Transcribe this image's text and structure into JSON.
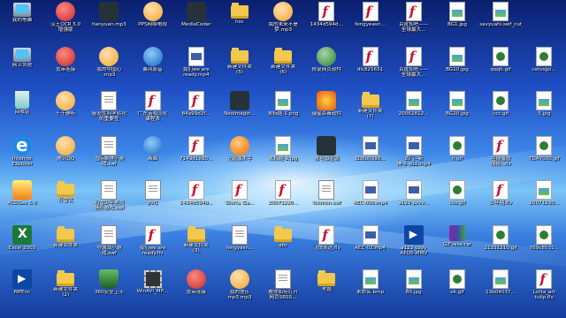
{
  "desktop": {
    "icons": [
      {
        "label": "我的电脑",
        "icon": "computer-icon",
        "kind": "computer",
        "col": 0,
        "row": 0
      },
      {
        "label": "汉王OCR 5.0\n增强版",
        "icon": "hanwang-ocr-icon",
        "kind": "round-red",
        "col": 1,
        "row": 0
      },
      {
        "label": "tianyuan.mp3",
        "icon": "mp3-file-icon",
        "kind": "dark",
        "col": 2,
        "row": 0
      },
      {
        "label": "PPS网络电视",
        "icon": "pps-tv-icon",
        "kind": "face",
        "col": 3,
        "row": 0
      },
      {
        "label": "MediaCoder",
        "icon": "mediacoder-icon",
        "kind": "dark",
        "col": 4,
        "row": 0
      },
      {
        "label": "hoc",
        "icon": "folder-icon",
        "kind": "folder",
        "col": 5,
        "row": 0
      },
      {
        "label": "我的未来不是\n梦.mp3",
        "icon": "mp3-file-icon",
        "kind": "face",
        "col": 6,
        "row": 0
      },
      {
        "label": "1434d594d…",
        "icon": "flash-file-icon",
        "kind": "flash",
        "col": 7,
        "row": 0
      },
      {
        "label": "fengyeasn…",
        "icon": "flash-file-icon",
        "kind": "flash",
        "col": 8,
        "row": 0
      },
      {
        "label": "百度知吧——\n全球最大…",
        "icon": "flash-file-icon",
        "kind": "flash",
        "col": 9,
        "row": 0
      },
      {
        "label": "BG1.jpg",
        "icon": "image-file-icon",
        "kind": "pic",
        "col": 10,
        "row": 0
      },
      {
        "label": "savyuahi.swf_cut_with…",
        "icon": "image-file-icon",
        "kind": "pic",
        "col": 11,
        "row": 0
      },
      {
        "label": "网上邻居",
        "icon": "network-icon",
        "kind": "computer",
        "col": 0,
        "row": 1
      },
      {
        "label": "宽带连接",
        "icon": "broadband-icon",
        "kind": "round-red",
        "col": 1,
        "row": 1
      },
      {
        "label": "我的中国心\n.mp3",
        "icon": "mp3-file-icon",
        "kind": "face",
        "col": 2,
        "row": 1
      },
      {
        "label": "暴风影音",
        "icon": "baofeng-icon",
        "kind": "round-blue",
        "col": 3,
        "row": 1
      },
      {
        "label": "我们we are\nready.mp4",
        "icon": "mp4-file-icon",
        "kind": "mp4",
        "col": 4,
        "row": 1
      },
      {
        "label": "新建文件夹\n(5)",
        "icon": "folder-icon",
        "kind": "folder",
        "col": 5,
        "row": 1
      },
      {
        "label": "新建文件夹\n(6)",
        "icon": "folder-icon",
        "kind": "folder",
        "col": 6,
        "row": 1
      },
      {
        "label": "修复网页软件",
        "icon": "repair-icon",
        "kind": "round-green",
        "col": 7,
        "row": 1
      },
      {
        "label": "dlc825651",
        "icon": "flash-file-icon",
        "kind": "flash",
        "col": 8,
        "row": 1
      },
      {
        "label": "百度知吧——\n全球最大…",
        "icon": "flash-file-icon",
        "kind": "flash",
        "col": 9,
        "row": 1
      },
      {
        "label": "BG10.jpg",
        "icon": "image-file-icon",
        "kind": "pic",
        "col": 10,
        "row": 1
      },
      {
        "label": "qqqh.gif",
        "icon": "gif-file-icon",
        "kind": "gif",
        "col": 11,
        "row": 1
      },
      {
        "label": "cetvsjpi…",
        "icon": "gif-file-icon",
        "kind": "gif",
        "col": 12,
        "row": 1
      },
      {
        "label": "回收站",
        "icon": "recycle-bin-icon",
        "kind": "recycle",
        "col": 0,
        "row": 2
      },
      {
        "label": "千千静听",
        "icon": "ttplayer-icon",
        "kind": "face",
        "col": 1,
        "row": 2
      },
      {
        "label": "秘密性科学转化\n的重要性",
        "icon": "document-icon",
        "kind": "doc",
        "col": 2,
        "row": 2
      },
      {
        "label": "广东话粤同化\n课程表",
        "icon": "flash-file-icon",
        "kind": "flash",
        "col": 3,
        "row": 2
      },
      {
        "label": "84a99d2f…",
        "icon": "flash-file-icon",
        "kind": "flash",
        "col": 4,
        "row": 2
      },
      {
        "label": "NeoImagin…",
        "icon": "neoimaging-icon",
        "kind": "dark",
        "col": 5,
        "row": 2
      },
      {
        "label": "未标题-1.png",
        "icon": "image-file-icon",
        "kind": "pic",
        "col": 6,
        "row": 2
      },
      {
        "label": "瑞星杀毒软件",
        "icon": "rising-antivirus-icon",
        "kind": "lion",
        "col": 7,
        "row": 2
      },
      {
        "label": "新建文件夹\n(7)",
        "icon": "folder-icon",
        "kind": "folder",
        "col": 8,
        "row": 2
      },
      {
        "label": "20062812…",
        "icon": "image-file-icon",
        "kind": "pic",
        "col": 9,
        "row": 2
      },
      {
        "label": "BG20.jpg",
        "icon": "image-file-icon",
        "kind": "pic",
        "col": 10,
        "row": 2
      },
      {
        "label": "ccc.gif",
        "icon": "gif-file-icon",
        "kind": "gif",
        "col": 11,
        "row": 2
      },
      {
        "label": "5.jpg",
        "icon": "image-file-icon",
        "kind": "pic",
        "col": 12,
        "row": 2
      },
      {
        "label": "Internet\nExplorer",
        "icon": "internet-explorer-icon",
        "kind": "ie",
        "col": 0,
        "row": 3
      },
      {
        "label": "腾讯QQ",
        "icon": "qq-icon",
        "kind": "face",
        "col": 1,
        "row": 3
      },
      {
        "label": "国际象棋小游\n戏.swf",
        "icon": "document-icon",
        "kind": "doc",
        "col": 2,
        "row": 3
      },
      {
        "label": "画面",
        "icon": "screen-icon",
        "kind": "round-blue",
        "col": 3,
        "row": 3
      },
      {
        "label": "7149d1e20…",
        "icon": "flash-file-icon",
        "kind": "flash",
        "col": 4,
        "row": 3
      },
      {
        "label": "光影魔术手",
        "icon": "nEO-iMAGING-icon",
        "kind": "round-orange",
        "col": 5,
        "row": 3
      },
      {
        "label": "未标题-2.jpg",
        "icon": "image-file-icon",
        "kind": "pic",
        "col": 6,
        "row": 3
      },
      {
        "label": "账号加密锁",
        "icon": "lock-icon",
        "kind": "dark",
        "col": 7,
        "row": 3
      },
      {
        "label": "SD8b0936…",
        "icon": "mp4-file-icon",
        "kind": "mp4",
        "col": 8,
        "row": 3
      },
      {
        "label": "西门--新\n神-6_ALL.mp4",
        "icon": "mp4-file-icon",
        "kind": "mp4",
        "col": 9,
        "row": 3
      },
      {
        "label": "h.gif",
        "icon": "gif-file-icon",
        "kind": "gif",
        "col": 10,
        "row": 3
      },
      {
        "label": "在线播放\n视频...flv",
        "icon": "flash-file-icon",
        "kind": "flash",
        "col": 11,
        "row": 3
      },
      {
        "label": "TDA7000.gif",
        "icon": "gif-file-icon",
        "kind": "gif",
        "col": 12,
        "row": 3
      },
      {
        "label": "ACDSee 5.0",
        "icon": "acdsee-icon",
        "kind": "acd",
        "col": 0,
        "row": 4
      },
      {
        "label": "打雪仗",
        "icon": "folder-icon",
        "kind": "folder",
        "col": 1,
        "row": 4
      },
      {
        "label": "初雪少年男同\n情小游戏.swf",
        "icon": "document-icon",
        "kind": "doc",
        "col": 2,
        "row": 4
      },
      {
        "label": "pvl1",
        "icon": "document-icon",
        "kind": "doc",
        "col": 3,
        "row": 4
      },
      {
        "label": "1434d594d…",
        "icon": "flash-file-icon",
        "kind": "flash",
        "col": 4,
        "row": 4
      },
      {
        "label": "Gloria_Ga…",
        "icon": "flash-file-icon",
        "kind": "flash",
        "col": 5,
        "row": 4
      },
      {
        "label": "20071220…",
        "icon": "flash-file-icon",
        "kind": "flash",
        "col": 6,
        "row": 4
      },
      {
        "label": "fokmon.swf",
        "icon": "document-icon",
        "kind": "doc",
        "col": 7,
        "row": 4
      },
      {
        "label": "AEC-005.mp4",
        "icon": "mp4-file-icon",
        "kind": "mp4",
        "col": 8,
        "row": 4
      },
      {
        "label": "a123-pzvv…",
        "icon": "mp4-file-icon",
        "kind": "mp4",
        "col": 9,
        "row": 4
      },
      {
        "label": "kku.gif",
        "icon": "gif-file-icon",
        "kind": "gif",
        "col": 10,
        "row": 4
      },
      {
        "label": "少年期.flv",
        "icon": "flash-file-icon",
        "kind": "flash",
        "col": 11,
        "row": 4
      },
      {
        "label": "20071230…",
        "icon": "image-file-icon",
        "kind": "pic",
        "col": 12,
        "row": 4
      },
      {
        "label": "Excel 2003",
        "icon": "excel-icon",
        "kind": "excel",
        "col": 0,
        "row": 5
      },
      {
        "label": "新建文件夹",
        "icon": "folder-icon",
        "kind": "folder",
        "col": 1,
        "row": 5
      },
      {
        "label": "夺城战小游\n戏.swf",
        "icon": "document-icon",
        "kind": "doc",
        "col": 2,
        "row": 5
      },
      {
        "label": "我们we are\nready.flv",
        "icon": "flash-file-icon",
        "kind": "flash",
        "col": 3,
        "row": 5
      },
      {
        "label": "新建文件夹\n(3)",
        "icon": "folder-icon",
        "kind": "folder",
        "col": 4,
        "row": 5
      },
      {
        "label": "fengyasn…",
        "icon": "document-icon",
        "kind": "doc",
        "col": 5,
        "row": 5
      },
      {
        "label": "abc",
        "icon": "folder-icon",
        "kind": "folder",
        "col": 6,
        "row": 5
      },
      {
        "label": "飞快表达.flv",
        "icon": "flash-file-icon",
        "kind": "flash",
        "col": 7,
        "row": 5
      },
      {
        "label": "AEC-02.mp4",
        "icon": "mp4-file-icon",
        "kind": "mp4",
        "col": 8,
        "row": 5
      },
      {
        "label": "a123-pzvv\nAEO5-MMV",
        "icon": "mpeg-file-icon",
        "kind": "mpeg",
        "col": 9,
        "row": 5
      },
      {
        "label": "GIFsave.rar",
        "icon": "winrar-icon",
        "kind": "winrar",
        "col": 10,
        "row": 5
      },
      {
        "label": "21331210.gif",
        "icon": "gif-file-icon",
        "kind": "gif",
        "col": 11,
        "row": 5
      },
      {
        "label": "769c8531…",
        "icon": "gif-file-icon",
        "kind": "gif",
        "col": 12,
        "row": 5
      },
      {
        "label": "MPEnc",
        "icon": "mpenc-icon",
        "kind": "mpeg",
        "col": 0,
        "row": 6
      },
      {
        "label": "新建文件夹\n(2)",
        "icon": "folder-icon",
        "kind": "folder",
        "col": 1,
        "row": 6
      },
      {
        "label": "360安全卫士",
        "icon": "360-safe-icon",
        "kind": "shield",
        "col": 2,
        "row": 6
      },
      {
        "label": "WinAVI_MP…",
        "icon": "winavi-icon",
        "kind": "film",
        "col": 3,
        "row": 6
      },
      {
        "label": "宽带连接",
        "icon": "broadband-icon",
        "kind": "round-red",
        "col": 4,
        "row": 6
      },
      {
        "label": "我的快乐\nmp3.mp3",
        "icon": "mp3-file-icon",
        "kind": "face",
        "col": 5,
        "row": 6
      },
      {
        "label": "教你如何打开\n网页SRSS…",
        "icon": "document-icon",
        "kind": "doc",
        "col": 6,
        "row": 6
      },
      {
        "label": "考题",
        "icon": "folder-icon",
        "kind": "folder",
        "col": 7,
        "row": 6
      },
      {
        "label": "未命名.bmp",
        "icon": "image-file-icon",
        "kind": "pic",
        "col": 8,
        "row": 6
      },
      {
        "label": "B5.jpg",
        "icon": "image-file-icon",
        "kind": "pic",
        "col": 9,
        "row": 6
      },
      {
        "label": "ok.gif",
        "icon": "gif-file-icon",
        "kind": "gif",
        "col": 10,
        "row": 6
      },
      {
        "label": "13b04037…",
        "icon": "image-file-icon",
        "kind": "pic",
        "col": 11,
        "row": 6
      },
      {
        "label": "Lotta_art\ntulip.flv",
        "icon": "flash-file-icon",
        "kind": "flash",
        "col": 12,
        "row": 6
      }
    ]
  }
}
